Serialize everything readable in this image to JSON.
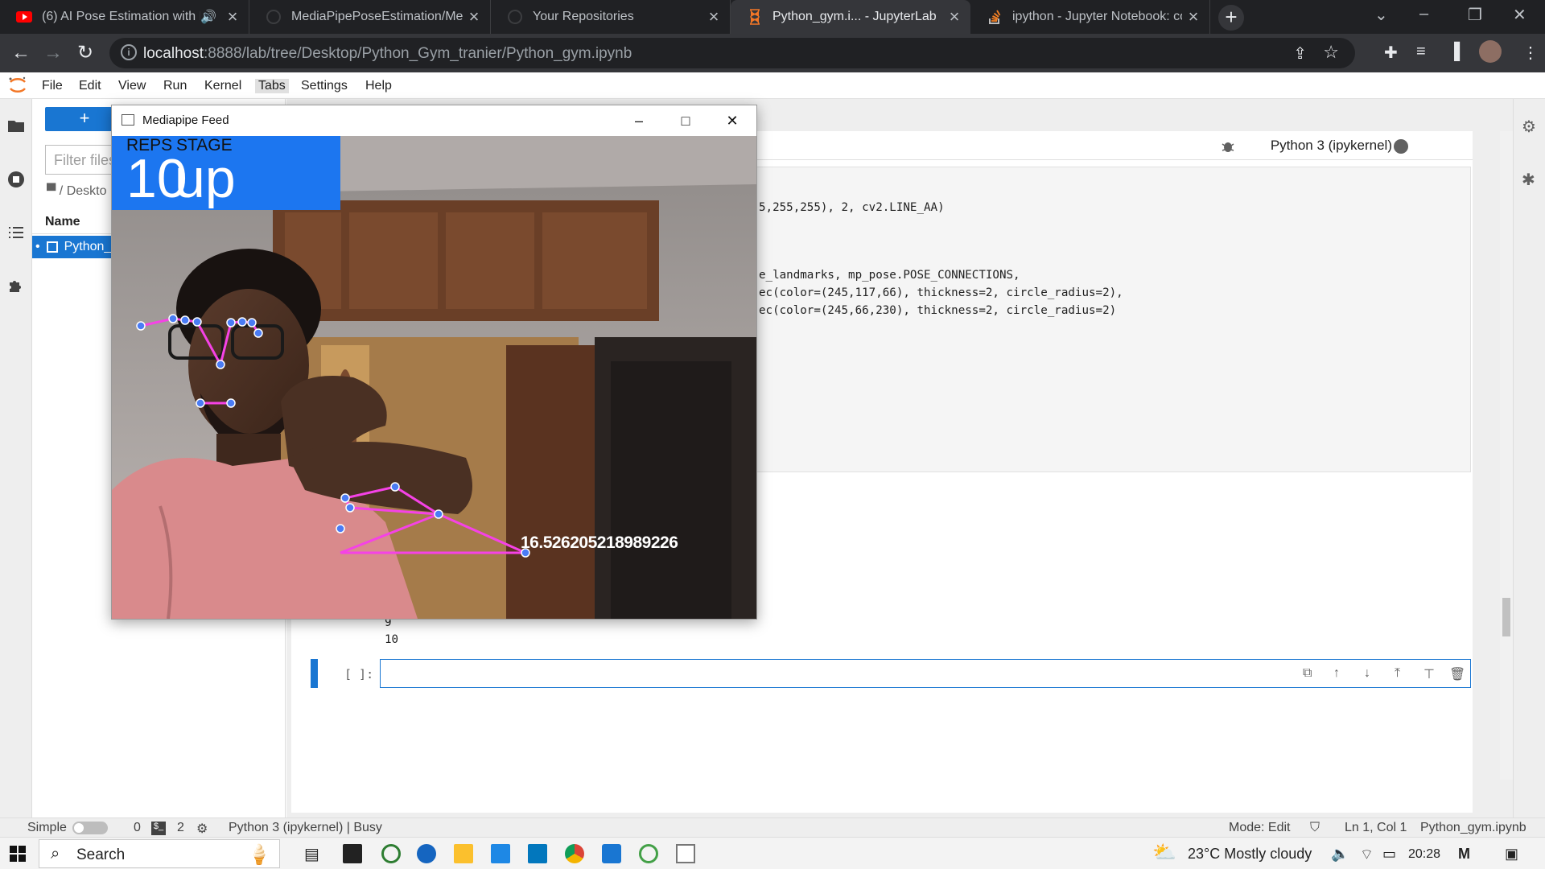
{
  "browser": {
    "tabs": [
      {
        "title": "(6) AI Pose Estimation with Py",
        "active": false
      },
      {
        "title": "MediaPipePoseEstimation/Media",
        "active": false
      },
      {
        "title": "Your Repositories",
        "active": false
      },
      {
        "title": "Python_gym.i... - JupyterLab",
        "active": true
      },
      {
        "title": "ipython - Jupyter Notebook: com",
        "active": false
      }
    ],
    "url_host": "localhost",
    "url_path": ":8888/lab/tree/Desktop/Python_Gym_tranier/Python_gym.ipynb"
  },
  "menubar": {
    "items": [
      "File",
      "Edit",
      "View",
      "Run",
      "Kernel",
      "Tabs",
      "Settings",
      "Help"
    ]
  },
  "filebrowser": {
    "new_label": "+",
    "filter_placeholder": "Filter files",
    "breadcrumb": "/ Deskto",
    "column_name": "Name",
    "selected_file": "Python_"
  },
  "notebook": {
    "kernel": "Python 3 (ipykernel)",
    "code_lines": [
      "5,255,255), 2, cv2.LINE_AA)",
      "e_landmarks, mp_pose.POSE_CONNECTIONS,",
      "ec(color=(245,117,66), thickness=2, circle_radius=2),",
      "ec(color=(245,66,230), thickness=2, circle_radius=2)"
    ],
    "output_lines": [
      "9",
      "10"
    ],
    "prompt": "[ ]:"
  },
  "mediapipe": {
    "window_title": "Mediapipe Feed",
    "reps_label": "REPS",
    "stage_label": "STAGE",
    "reps_value": "10",
    "stage_value": "up",
    "angle_readout": "16.526205218989226"
  },
  "statusbar": {
    "simple": "Simple",
    "count_a": "0",
    "count_b": "2",
    "kernel_status": "Python 3 (ipykernel) | Busy",
    "mode": "Mode: Edit",
    "cursor": "Ln 1, Col 1",
    "filename": "Python_gym.ipynb"
  },
  "taskbar": {
    "search_label": "Search",
    "weather": "23°C  Mostly cloudy",
    "time": "20:28"
  },
  "colors": {
    "jupyter_blue": "#1976d2",
    "reps_box": "#1c76f0",
    "landmark_line": "#f542e6",
    "landmark_dot": "#4a7cf5"
  }
}
